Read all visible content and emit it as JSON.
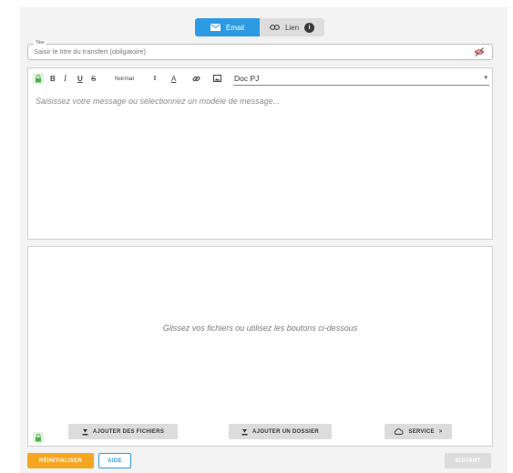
{
  "toggle": {
    "email_label": "Email",
    "lien_label": "Lien",
    "lien_badge": "i",
    "email_icon": "mail-icon",
    "lien_icon": "link-icon"
  },
  "title_field": {
    "legend": "Titre",
    "placeholder": "Saisir le titre du transfert (obligatoire)",
    "icon": "no-eye-icon"
  },
  "toolbar": {
    "bold": "B",
    "italic": "I",
    "underline": "U",
    "strike": "S",
    "size_select": "Normal",
    "size_arrows": "⇕",
    "text_color": "A",
    "template_select": "Doc PJ",
    "template_caret": "▾"
  },
  "editor": {
    "placeholder": "Saisissez votre message ou sélectionnez un modèle de message..."
  },
  "dropzone": {
    "text": "Glissez vos fichiers ou utilisez les boutons ci-dessous",
    "add_files": "AJOUTER DES FICHIERS",
    "add_folder": "AJOUTER UN DOSSIER",
    "service": "SERVICE",
    "service_chevron": ">"
  },
  "footer": {
    "reset": "RÉINITIALISER",
    "help": "AIDE",
    "next": "SUIVANT"
  },
  "colors": {
    "accent_blue": "#2d9be4",
    "reset_orange": "#f5a623",
    "disabled_gray": "#dcdcdc",
    "lock_green": "#4caf50"
  }
}
